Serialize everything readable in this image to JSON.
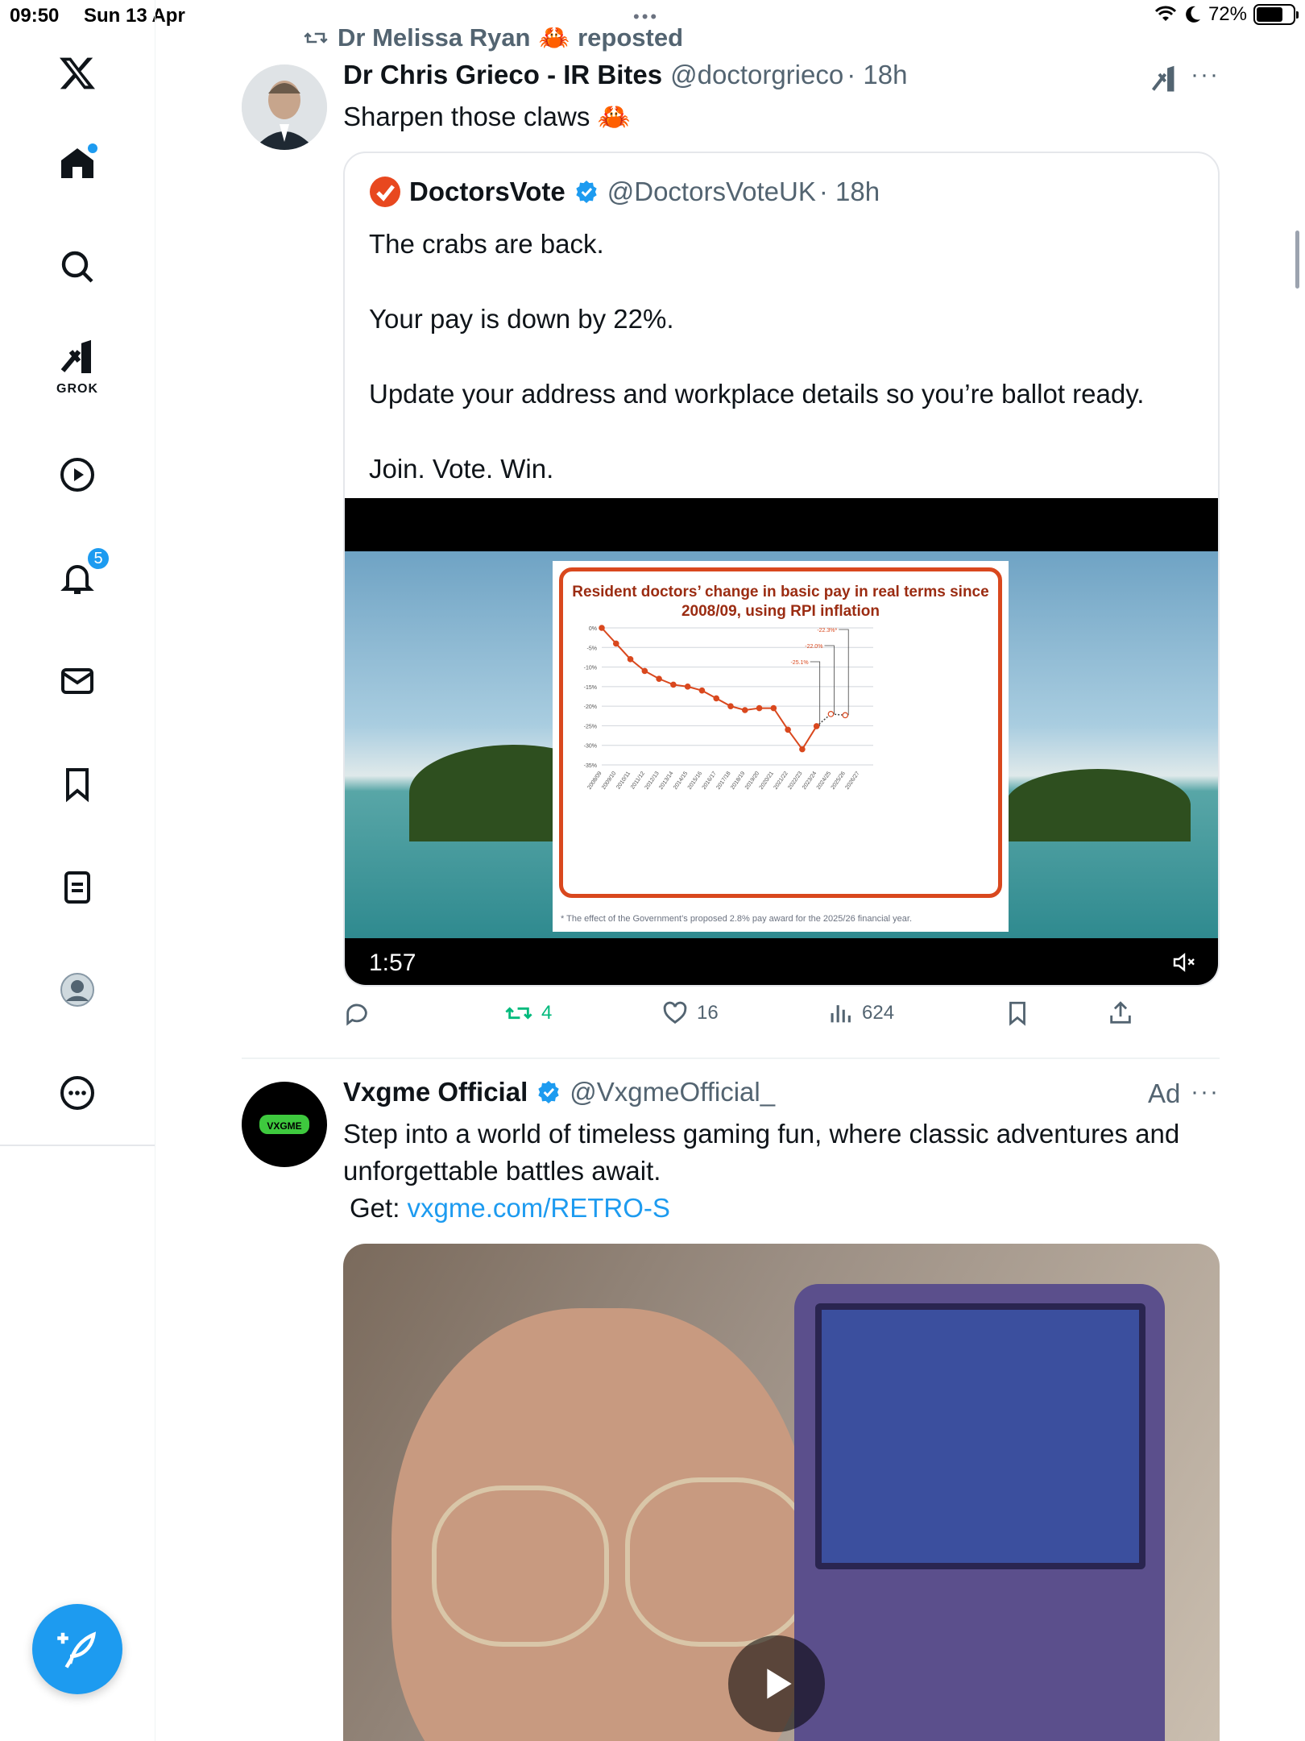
{
  "status": {
    "time": "09:50",
    "date": "Sun 13 Apr",
    "battery": "72%",
    "battery_level": 0.72
  },
  "sidebar": {
    "items": [
      {
        "name": "X"
      },
      {
        "name": "Home"
      },
      {
        "name": "Search"
      },
      {
        "name": "Grok",
        "label": "GROK"
      },
      {
        "name": "Video"
      },
      {
        "name": "Notifications",
        "badge": "5"
      },
      {
        "name": "Messages"
      },
      {
        "name": "Bookmarks"
      },
      {
        "name": "Lists"
      },
      {
        "name": "Profile"
      },
      {
        "name": "More"
      }
    ]
  },
  "tweet1": {
    "repost_by": "Dr Melissa Ryan",
    "repost_suffix": "reposted",
    "author_name": "Dr Chris Grieco - IR Bites",
    "author_handle": "@doctorgrieco",
    "time": "· 18h",
    "text": "Sharpen those claws",
    "quote": {
      "author_name": "DoctorsVote",
      "author_handle": "@DoctorsVoteUK",
      "time": "· 18h",
      "lines": [
        "The crabs are back.",
        "Your pay is down by 22%.",
        "Update your address and workplace details so you’re ballot ready.",
        "Join. Vote. Win."
      ],
      "video_duration": "1:57"
    },
    "stats": {
      "replies": "",
      "reposts": "4",
      "likes": "16",
      "views": "624"
    }
  },
  "tweet2": {
    "author_name": "Vxgme Official",
    "author_handle": "@VxgmeOfficial_",
    "ad_label": "Ad",
    "text_line1": "Step into a world of timeless gaming fun, where classic adventures and",
    "text_line2": "unforgettable battles await.",
    "get_prefix": "Get:",
    "link": "vxgme.com/RETRO-S",
    "logo_text": "VXGME"
  },
  "colors": {
    "accent": "#1d9bf0",
    "repost_green": "#00ba7c",
    "chart_red": "#d9481e"
  },
  "chart_data": {
    "type": "line",
    "title": "Resident doctors’ change in basic pay in real terms since 2008/09, using RPI inflation",
    "footnote": "* The effect of the Government’s proposed 2.8% pay award for the 2025/26 financial year.",
    "categories": [
      "2008/09",
      "2009/10",
      "2010/11",
      "2011/12",
      "2012/13",
      "2013/14",
      "2014/15",
      "2015/16",
      "2016/17",
      "2017/18",
      "2018/19",
      "2019/20",
      "2020/21",
      "2021/22",
      "2022/23",
      "2023/24",
      "2024/25",
      "2025/26",
      "2026/27"
    ],
    "series": [
      {
        "values": [
          0,
          -4,
          -8,
          -11,
          -13,
          -14.5,
          -15,
          -16,
          -18,
          -20,
          -21,
          -20.5,
          -20.5,
          -26,
          -31,
          -25.1,
          -22,
          -22.3,
          null
        ]
      }
    ],
    "annotations": [
      "-25.1%",
      "-22.0%",
      "-22.3%*"
    ],
    "yticks": [
      "0%",
      "-5%",
      "-10%",
      "-15%",
      "-20%",
      "-25%",
      "-30%",
      "-35%"
    ],
    "ylim": [
      -35,
      0
    ],
    "grid": true
  }
}
